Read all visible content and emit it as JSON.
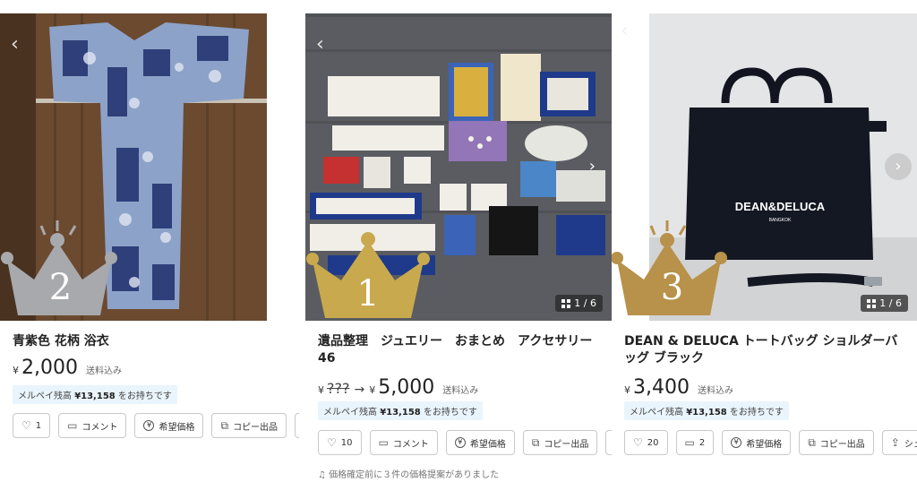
{
  "colors": {
    "balance_bg": "#eaf4fc",
    "silver_crown": "#a8a9ad",
    "gold_crown": "#c9a94e",
    "bronze_crown": "#b8914a"
  },
  "cards": [
    {
      "rank": "2",
      "title": "青紫色 花柄 浴衣",
      "yen_symbol": "¥",
      "price": "2,000",
      "shipping": "送料込み",
      "balance_prefix": "メルペイ残高",
      "balance_amount": "¥13,158",
      "balance_suffix": "をお持ちです",
      "like_count": "1",
      "comment_label": "コメント",
      "offer_label": "希望価格",
      "copy_label": "コピー出品"
    },
    {
      "rank": "1",
      "title": "遺品整理　ジュエリー　おまとめ　アクセサリー46",
      "yen_symbol": "¥",
      "old_price": "???",
      "price": "5,000",
      "shipping": "送料込み",
      "balance_prefix": "メルペイ残高",
      "balance_amount": "¥13,158",
      "balance_suffix": "をお持ちです",
      "like_count": "10",
      "comment_label": "コメント",
      "offer_label": "希望価格",
      "copy_label": "コピー出品",
      "image_counter": "1 / 6",
      "note": "価格確定前に３件の価格提案がありました"
    },
    {
      "rank": "3",
      "title": "DEAN & DELUCA トートバッグ ショルダーバッグ ブラック",
      "yen_symbol": "¥",
      "price": "3,400",
      "shipping": "送料込み",
      "balance_prefix": "メルペイ残高",
      "balance_amount": "¥13,158",
      "balance_suffix": "をお持ちです",
      "like_count": "20",
      "comment_count": "2",
      "offer_label": "希望価格",
      "copy_label": "コピー出品",
      "share_label": "シェ",
      "image_counter": "1 / 6",
      "bag_text": "DEAN&DELUCA",
      "bag_subtext": "BANGKOK"
    }
  ]
}
